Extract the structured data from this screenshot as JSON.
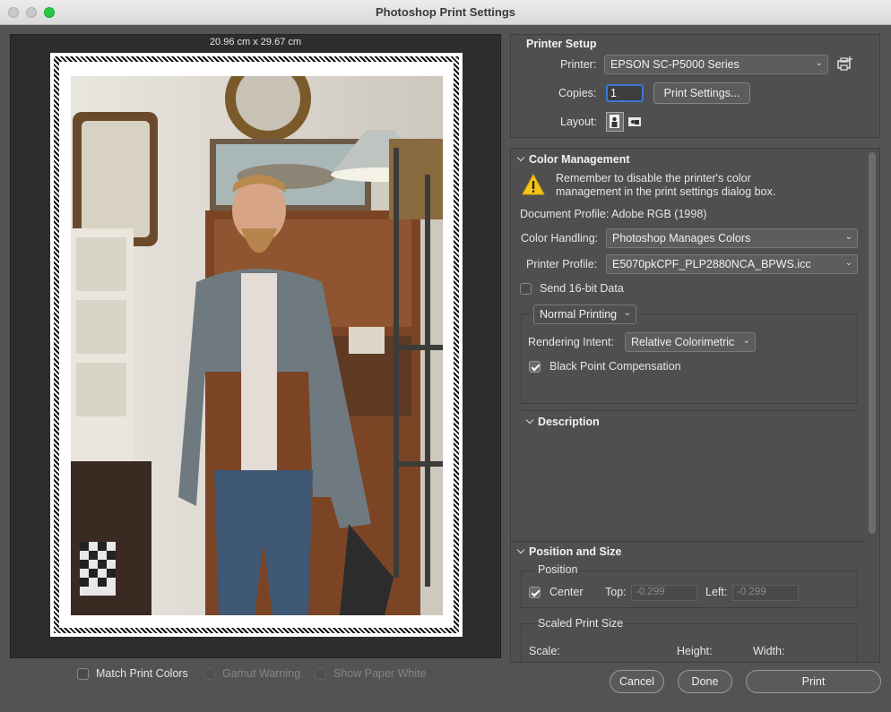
{
  "window": {
    "title": "Photoshop Print Settings"
  },
  "preview": {
    "dimensions": "20.96 cm x 29.67 cm"
  },
  "bottom_options": {
    "match_print_colors": "Match Print Colors",
    "gamut_warning": "Gamut Warning",
    "show_paper_white": "Show Paper White"
  },
  "printer_setup": {
    "title": "Printer Setup",
    "printer_label": "Printer:",
    "printer_value": "EPSON SC-P5000 Series",
    "copies_label": "Copies:",
    "copies_value": "1",
    "print_settings_button": "Print Settings...",
    "layout_label": "Layout:"
  },
  "color_management": {
    "title": "Color Management",
    "warning_text": "Remember to disable the printer's color management in the print settings dialog box.",
    "document_profile": "Document Profile: Adobe RGB (1998)",
    "color_handling_label": "Color Handling:",
    "color_handling_value": "Photoshop Manages Colors",
    "printer_profile_label": "Printer Profile:",
    "printer_profile_value": "E5070pkCPF_PLP2880NCA_BPWS.icc",
    "send_16bit": "Send 16-bit Data",
    "normal_printing": "Normal Printing",
    "rendering_intent_label": "Rendering Intent:",
    "rendering_intent_value": "Relative Colorimetric",
    "black_point": "Black Point Compensation",
    "description": "Description"
  },
  "position_size": {
    "title": "Position and Size",
    "position": "Position",
    "center": "Center",
    "top_label": "Top:",
    "top_value": "-0.299",
    "left_label": "Left:",
    "left_value": "-0.299",
    "scaled_print_size": "Scaled Print Size",
    "scale_label": "Scale:",
    "height_label": "Height:",
    "width_label": "Width:"
  },
  "buttons": {
    "cancel": "Cancel",
    "done": "Done",
    "print": "Print"
  }
}
